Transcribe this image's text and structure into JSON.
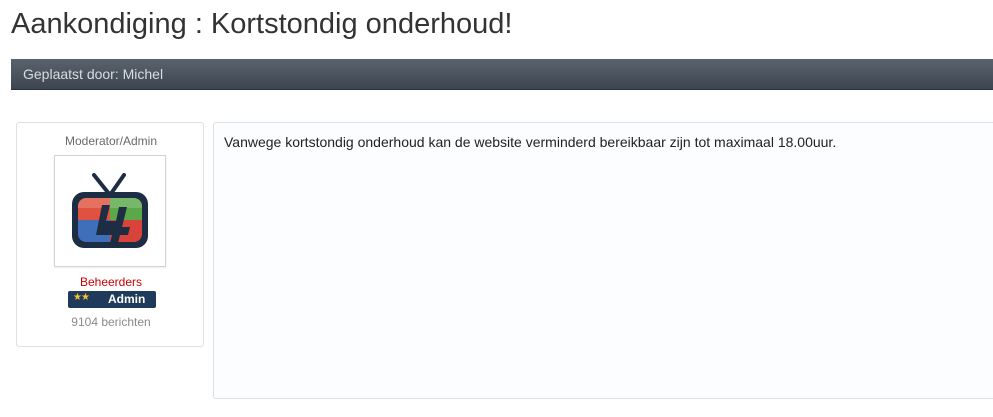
{
  "page": {
    "title": "Aankondiging : Kortstondig onderhoud!"
  },
  "post_header": {
    "posted_by": "Geplaatst door: Michel"
  },
  "author": {
    "role_title": "Moderator/Admin",
    "avatar_icon": "tv-logo-icon",
    "group_name": "Beheerders",
    "group_color": "#cc0000",
    "rank": {
      "stars": "★★",
      "label": "Admin",
      "color": "#1f3a5a"
    },
    "post_count": "9104 berichten"
  },
  "message": {
    "body": "Vanwege kortstondig onderhoud kan de website verminderd bereikbaar zijn tot maximaal 18.00uur."
  }
}
